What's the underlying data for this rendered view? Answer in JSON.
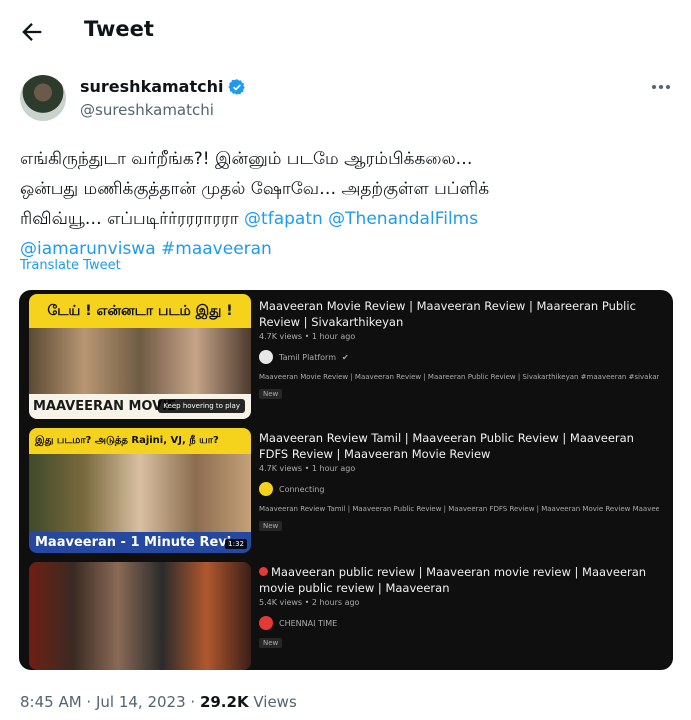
{
  "header": {
    "title": "Tweet"
  },
  "author": {
    "name": "sureshkamatchi",
    "handle": "@sureshkamatchi"
  },
  "tweet": {
    "line1": "எங்கிருந்துடா வர்றீங்க?! இன்னும் படமே ஆரம்பிக்கலை…",
    "line2": "ஒன்பது மணிக்குத்தான் முதல் ஷோவே… அதற்குள்ள பப்ளிக்",
    "line3_text": "ரிவிவ்யூ… எப்படிர்ர்ரரராரரா ",
    "mention1": "@tfapatn",
    "mention2": "@ThenandalFilms",
    "mention3": "@iamarunviswa",
    "hashtag": "#maaveeran",
    "translate": "Translate Tweet"
  },
  "videos": [
    {
      "thumb_top": "டேய் ! என்னடா படம் இது !",
      "thumb_bottom": "MAAVEERAN MOVIE",
      "hover": "Keep hovering to play",
      "title": "Maaveeran Movie Review | Maaveeran Review | Maareeran Public Review | Sivakarthikeyan",
      "meta": "4.7K views • 1 hour ago",
      "channel": "Tamil Platform",
      "description": "Maaveeran Movie Review | Maaveeran Review | Maareeran Public Review | Sivakarthikeyan #maaveeran #sivakarthikeyan ...",
      "badge": "New"
    },
    {
      "thumb_top": "இது படமா? அடுத்த Rajini, VJ, நீ யா?",
      "thumb_bottom": "Maaveeran - 1 Minute Revi",
      "duration": "1:32",
      "title": "Maaveeran Review Tamil | Maaveeran Public Review | Maaveeran FDFS Review | Maaveeran Movie Review",
      "meta": "4.7K views • 1 hour ago",
      "channel": "Connecting",
      "description": "Maaveeran Review Tamil | Maaveeran Public Review | Maaveeran FDFS Review | Maaveeran Movie Review Maaveeran public ...",
      "badge": "New"
    },
    {
      "title": "Maaveeran public review | Maaveeran movie review | Maaveeran movie public review | Maaveeran",
      "meta": "5.4K views • 2 hours ago",
      "channel": "CHENNAI TIME",
      "badge": "New"
    }
  ],
  "footer": {
    "time": "8:45 AM · Jul 14, 2023 · ",
    "views_count": "29.2K",
    "views_label": " Views"
  },
  "colors": {
    "link": "#1d9bf0",
    "verified": "#1d9bf0",
    "muted": "#536471"
  }
}
